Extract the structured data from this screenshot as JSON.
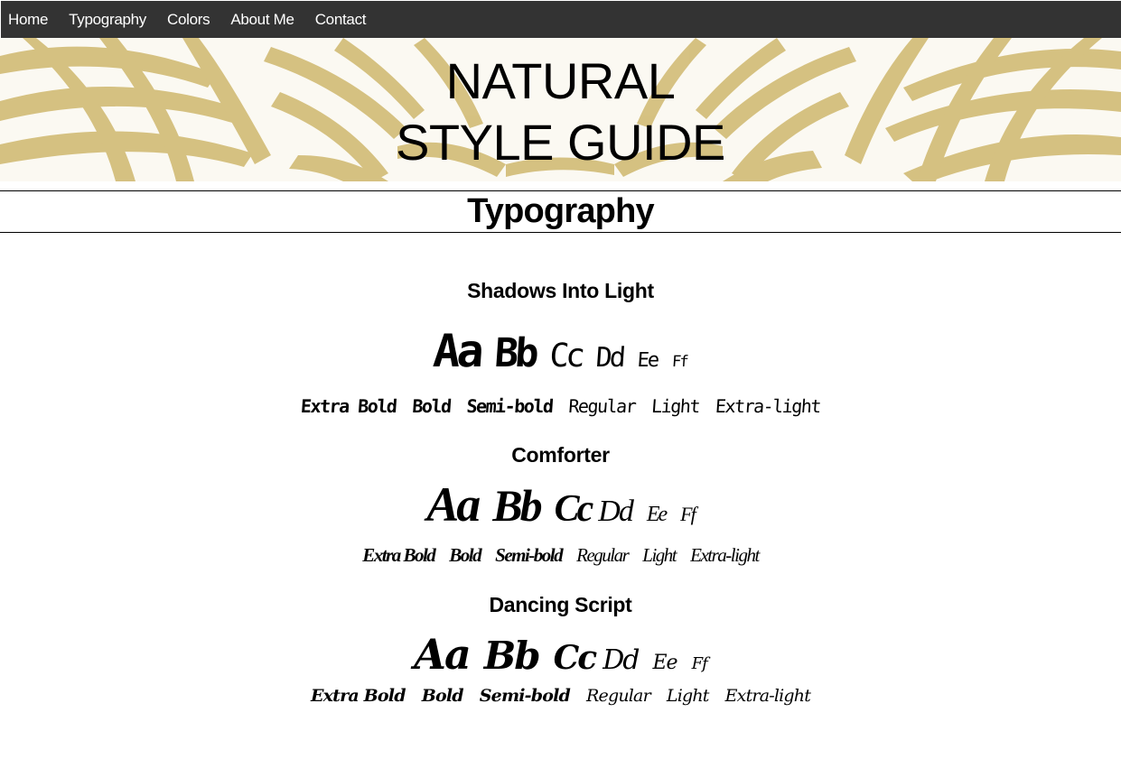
{
  "nav": {
    "items": [
      {
        "label": "Home"
      },
      {
        "label": "Typography"
      },
      {
        "label": "Colors"
      },
      {
        "label": "About Me"
      },
      {
        "label": "Contact"
      }
    ]
  },
  "hero": {
    "title_line1": "NATURAL",
    "title_line2": "STYLE GUIDE"
  },
  "section": {
    "title": "Typography"
  },
  "fonts": [
    {
      "name": "Shadows Into Light",
      "glyphs": [
        "Aa",
        "Bb",
        "Cc",
        "Dd",
        "Ee",
        "Ff"
      ],
      "weights": [
        "Extra Bold",
        "Bold",
        "Semi-bold",
        "Regular",
        "Light",
        "Extra-light"
      ]
    },
    {
      "name": "Comforter",
      "glyphs": [
        "Aa",
        "Bb",
        "Cc",
        "Dd",
        "Ee",
        "Ff"
      ],
      "weights": [
        "Extra Bold",
        "Bold",
        "Semi-bold",
        "Regular",
        "Light",
        "Extra-light"
      ]
    },
    {
      "name": "Dancing Script",
      "glyphs": [
        "Aa",
        "Bb",
        "Cc",
        "Dd",
        "Ee",
        "Ff"
      ],
      "weights": [
        "Extra Bold",
        "Bold",
        "Semi-bold",
        "Regular",
        "Light",
        "Extra-light"
      ]
    }
  ],
  "colors": {
    "navbar_bg": "#333333",
    "nav_text": "#ffffff",
    "hero_gold": "#d4bf7c",
    "hero_bg": "#fbf9f2"
  }
}
